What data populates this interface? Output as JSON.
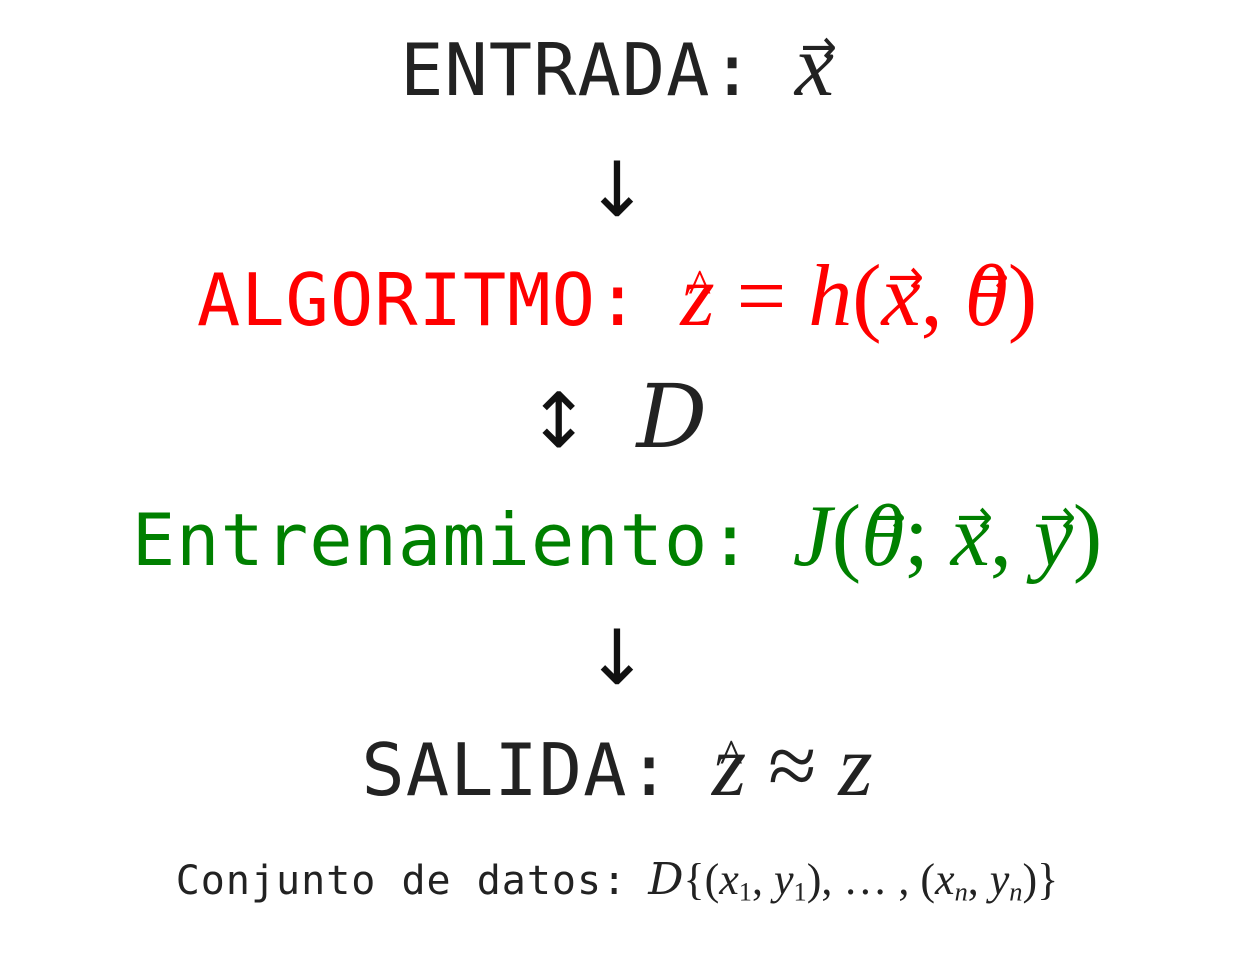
{
  "entrada": {
    "label": "ENTRADA:"
  },
  "algoritmo": {
    "label": "ALGORITMO:",
    "color": "#ff0000"
  },
  "entrenamiento": {
    "label": "Entrenamiento:",
    "color": "#008000"
  },
  "salida": {
    "label": "SALIDA:"
  },
  "dataset": {
    "label": "Conjunto de datos:"
  },
  "arrows": {
    "down": "↓",
    "updown": "↕"
  }
}
